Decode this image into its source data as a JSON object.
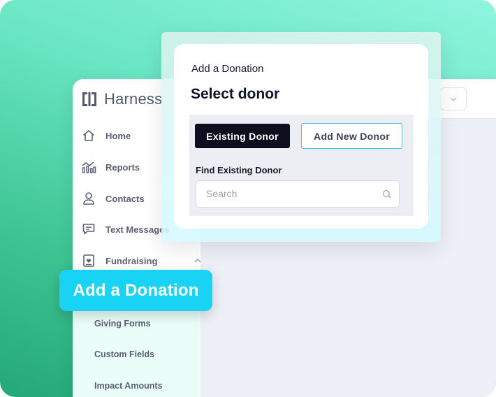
{
  "app": {
    "brand": "Harness",
    "sidebar": {
      "items": [
        {
          "label": "Home",
          "icon": "home-icon"
        },
        {
          "label": "Reports",
          "icon": "chart-icon"
        },
        {
          "label": "Contacts",
          "icon": "user-icon"
        },
        {
          "label": "Text Messages",
          "icon": "message-icon"
        },
        {
          "label": "Fundraising",
          "icon": "heart-card-icon",
          "expanded": true
        }
      ],
      "subitems": [
        "Giving Forms",
        "Custom Fields",
        "Impact Amounts"
      ]
    }
  },
  "callout": {
    "label": "Add a Donation"
  },
  "modal": {
    "eyebrow": "Add a Donation",
    "title": "Select donor",
    "buttons": {
      "existing": "Existing Donor",
      "new": "Add New Donor"
    },
    "find_label": "Find Existing Donor",
    "search": {
      "placeholder": "Search",
      "value": ""
    }
  },
  "colors": {
    "accent_cyan": "#18d3f4",
    "primary_dark": "#0d0f1f",
    "outline_cyan": "#3cc6dc",
    "bg_green": "#3fc594"
  }
}
